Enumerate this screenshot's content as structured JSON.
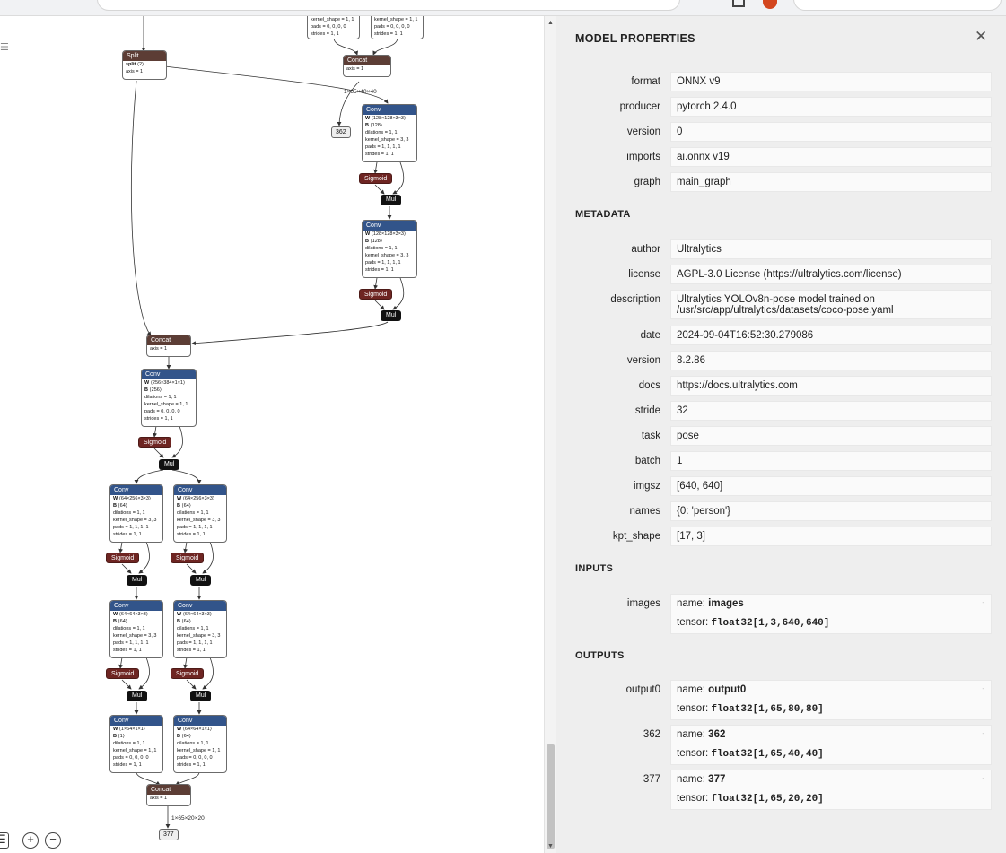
{
  "graph": {
    "top_nodes": {
      "left_partial": [
        "kernel_shape = 1, 1",
        "pads = 0, 0, 0, 0",
        "strides = 1, 1"
      ],
      "right_partial": [
        "kernel_shape = 1, 1",
        "pads = 0, 0, 0, 0",
        "strides = 1, 1"
      ]
    },
    "split": {
      "title": "Split",
      "line1_key": "split",
      "line1_val": "⟨2⟩",
      "line2": "axis = 1"
    },
    "concat_top": {
      "title": "Concat",
      "line1": "axis = 1"
    },
    "edge_label_top": "1×65×40×40",
    "output_362": "362",
    "conv_a": {
      "title": "Conv",
      "w": "⟨128×128×3×3⟩",
      "b": "⟨128⟩",
      "lines": [
        "dilations = 1, 1",
        "kernel_shape = 3, 3",
        "pads = 1, 1, 1, 1",
        "strides = 1, 1"
      ]
    },
    "conv_b": {
      "title": "Conv",
      "w": "⟨128×128×3×3⟩",
      "b": "⟨128⟩",
      "lines": [
        "dilations = 1, 1",
        "kernel_shape = 3, 3",
        "pads = 1, 1, 1, 1",
        "strides = 1, 1"
      ]
    },
    "concat_mid": {
      "title": "Concat",
      "line1": "axis = 1"
    },
    "conv_c": {
      "title": "Conv",
      "w": "⟨256×384×1×1⟩",
      "b": "⟨256⟩",
      "lines": [
        "dilations = 1, 1",
        "kernel_shape = 1, 1",
        "pads = 0, 0, 0, 0",
        "strides = 1, 1"
      ]
    },
    "conv_d1": {
      "title": "Conv",
      "w": "⟨64×256×3×3⟩",
      "b": "⟨64⟩",
      "lines": [
        "dilations = 1, 1",
        "kernel_shape = 3, 3",
        "pads = 1, 1, 1, 1",
        "strides = 1, 1"
      ]
    },
    "conv_d2": {
      "title": "Conv",
      "w": "⟨64×256×3×3⟩",
      "b": "⟨64⟩",
      "lines": [
        "dilations = 1, 1",
        "kernel_shape = 3, 3",
        "pads = 1, 1, 1, 1",
        "strides = 1, 1"
      ]
    },
    "conv_e1": {
      "title": "Conv",
      "w": "⟨64×64×3×3⟩",
      "b": "⟨64⟩",
      "lines": [
        "dilations = 1, 1",
        "kernel_shape = 3, 3",
        "pads = 1, 1, 1, 1",
        "strides = 1, 1"
      ]
    },
    "conv_e2": {
      "title": "Conv",
      "w": "⟨64×64×3×3⟩",
      "b": "⟨64⟩",
      "lines": [
        "dilations = 1, 1",
        "kernel_shape = 3, 3",
        "pads = 1, 1, 1, 1",
        "strides = 1, 1"
      ]
    },
    "conv_f1": {
      "title": "Conv",
      "w": "⟨1×64×1×1⟩",
      "b": "⟨1⟩",
      "lines": [
        "dilations = 1, 1",
        "kernel_shape = 1, 1",
        "pads = 0, 0, 0, 0",
        "strides = 1, 1"
      ]
    },
    "conv_f2": {
      "title": "Conv",
      "w": "⟨64×64×1×1⟩",
      "b": "⟨64⟩",
      "lines": [
        "dilations = 1, 1",
        "kernel_shape = 1, 1",
        "pads = 0, 0, 0, 0",
        "strides = 1, 1"
      ]
    },
    "concat_bottom": {
      "title": "Concat",
      "line1": "axis = 1"
    },
    "edge_label_bottom": "1×65×20×20",
    "output_377": "377",
    "sigmoid_label": "Sigmoid",
    "mul_label": "Mul",
    "w_key": "W",
    "b_key": "B"
  },
  "panel": {
    "title": "MODEL PROPERTIES",
    "close_glyph": "✕",
    "model": [
      {
        "label": "format",
        "value": "ONNX v9"
      },
      {
        "label": "producer",
        "value": "pytorch 2.4.0"
      },
      {
        "label": "version",
        "value": "0"
      },
      {
        "label": "imports",
        "value": "ai.onnx v19"
      },
      {
        "label": "graph",
        "value": "main_graph"
      }
    ],
    "metadata_title": "METADATA",
    "metadata": [
      {
        "label": "author",
        "value": "Ultralytics"
      },
      {
        "label": "license",
        "value": "AGPL-3.0 License (https://ultralytics.com/license)"
      },
      {
        "label": "description",
        "value": "Ultralytics YOLOv8n-pose model trained on",
        "value2": "/usr/src/app/ultralytics/datasets/coco-pose.yaml"
      },
      {
        "label": "date",
        "value": "2024-09-04T16:52:30.279086"
      },
      {
        "label": "version",
        "value": "8.2.86"
      },
      {
        "label": "docs",
        "value": "https://docs.ultralytics.com"
      },
      {
        "label": "stride",
        "value": "32"
      },
      {
        "label": "task",
        "value": "pose"
      },
      {
        "label": "batch",
        "value": "1"
      },
      {
        "label": "imgsz",
        "value": "[640, 640]"
      },
      {
        "label": "names",
        "value": "{0: 'person'}"
      },
      {
        "label": "kpt_shape",
        "value": "[17, 3]"
      }
    ],
    "inputs_title": "INPUTS",
    "inputs": [
      {
        "label": "images",
        "name_prefix": "name: ",
        "name": "images",
        "tensor_prefix": "tensor: ",
        "tensor": "float32[1,3,640,640]"
      }
    ],
    "outputs_title": "OUTPUTS",
    "outputs": [
      {
        "label": "output0",
        "name_prefix": "name: ",
        "name": "output0",
        "tensor_prefix": "tensor: ",
        "tensor": "float32[1,65,80,80]"
      },
      {
        "label": "362",
        "name_prefix": "name: ",
        "name": "362",
        "tensor_prefix": "tensor: ",
        "tensor": "float32[1,65,40,40]"
      },
      {
        "label": "377",
        "name_prefix": "name: ",
        "name": "377",
        "tensor_prefix": "tensor: ",
        "tensor": "float32[1,65,20,20]"
      }
    ],
    "expander_glyph": "-"
  },
  "icons": {
    "menu": "☰",
    "zoom_in": "+",
    "zoom_out": "−",
    "scroll_up": "▲",
    "scroll_down": "▼"
  }
}
